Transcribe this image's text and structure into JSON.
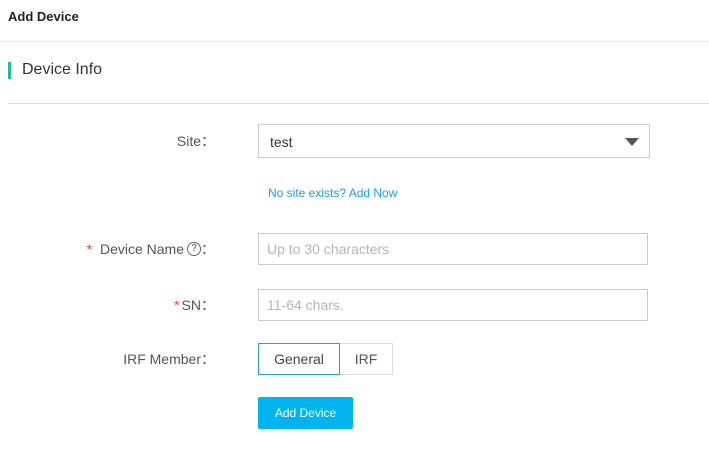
{
  "header": {
    "title": "Add Device"
  },
  "section": {
    "title": "Device Info",
    "accent_color": "#1fba9a"
  },
  "form": {
    "site": {
      "label": "Site",
      "colon": "：",
      "value": "test"
    },
    "site_link": "No site exists? Add Now",
    "device_name": {
      "required_mark": "*",
      "label": "Device Name",
      "help_icon": "question-circle-icon",
      "help_glyph": "?",
      "colon": "：",
      "placeholder": "Up to 30 characters"
    },
    "sn": {
      "required_mark": "*",
      "label": "SN",
      "colon": "：",
      "placeholder": "11-64 chars."
    },
    "irf_member": {
      "label": "IRF Member",
      "colon": "：",
      "options": [
        "General",
        "IRF"
      ],
      "selected": "General"
    },
    "submit_label": "Add Device"
  },
  "colors": {
    "primary": "#00b4ef",
    "link": "#1aa0e6",
    "required": "#e8453c",
    "active_border": "#23a6c8"
  }
}
